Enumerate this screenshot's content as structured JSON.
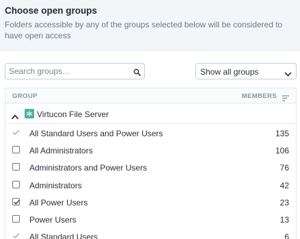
{
  "header": {
    "title": "Choose open groups",
    "subtitle": "Folders accessible by any of the groups selected below will be considered to have open access"
  },
  "search": {
    "placeholder": "Search groups..."
  },
  "filter": {
    "selected": "Show all groups"
  },
  "table": {
    "columns": {
      "group": "GROUP",
      "members": "MEMBERS"
    },
    "server": {
      "name": "Virtucon File Server",
      "expanded": true
    },
    "rows": [
      {
        "name": "All Standard Users and Power Users",
        "members": "135",
        "state": "implied"
      },
      {
        "name": "All Administrators",
        "members": "106",
        "state": "unchecked"
      },
      {
        "name": "Administrators and Power Users",
        "members": "76",
        "state": "unchecked"
      },
      {
        "name": "Administrators",
        "members": "42",
        "state": "unchecked"
      },
      {
        "name": "All Power Users",
        "members": "23",
        "state": "checked"
      },
      {
        "name": "Power Users",
        "members": "13",
        "state": "unchecked"
      },
      {
        "name": "All Standard Users",
        "members": "6",
        "state": "implied"
      }
    ]
  },
  "colors": {
    "server_icon": "#48b39a",
    "header_bg": "#f3f6f9"
  },
  "icons": {
    "search": "search-icon",
    "dropdown": "chevron-down-icon",
    "sort": "sort-icon",
    "collapse": "chevron-up-icon",
    "server": "server-icon"
  }
}
